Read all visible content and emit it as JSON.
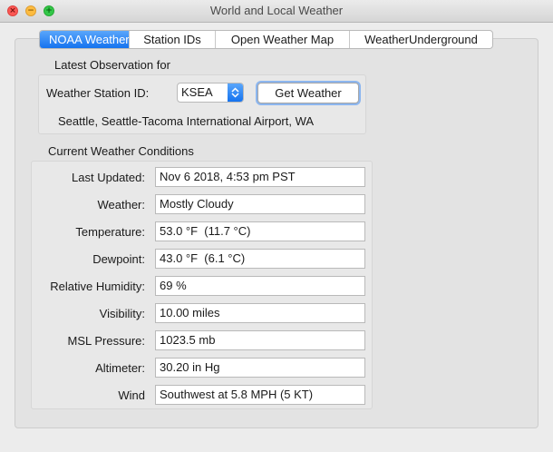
{
  "window": {
    "title": "World and Local Weather"
  },
  "tabs": [
    {
      "label": "NOAA Weather",
      "active": true
    },
    {
      "label": "Station IDs",
      "active": false
    },
    {
      "label": "Open Weather Map",
      "active": false
    },
    {
      "label": "WeatherUnderground",
      "active": false
    }
  ],
  "observation": {
    "group_label": "Latest Observation for",
    "station_label": "Weather Station ID:",
    "station_value": "KSEA",
    "get_button": "Get Weather",
    "location": "Seattle, Seattle-Tacoma International Airport, WA"
  },
  "conditions": {
    "group_label": "Current Weather Conditions",
    "rows": [
      {
        "label": "Last Updated:",
        "value": "Nov 6 2018, 4:53 pm PST"
      },
      {
        "label": "Weather:",
        "value": "Mostly Cloudy"
      },
      {
        "label": "Temperature:",
        "value": "53.0 °F  (11.7 °C)"
      },
      {
        "label": "Dewpoint:",
        "value": "43.0 °F  (6.1 °C)"
      },
      {
        "label": "Relative Humidity:",
        "value": "69 %"
      },
      {
        "label": "Visibility:",
        "value": "10.00 miles"
      },
      {
        "label": "MSL Pressure:",
        "value": "1023.5 mb"
      },
      {
        "label": "Altimeter:",
        "value": "30.20 in Hg"
      },
      {
        "label": "Wind",
        "value": "Southwest at 5.8 MPH (5 KT)"
      }
    ]
  },
  "colors": {
    "accent": "#1573ef",
    "close": "#fc5753",
    "minimize": "#fdbc40",
    "maximize": "#33c748"
  }
}
